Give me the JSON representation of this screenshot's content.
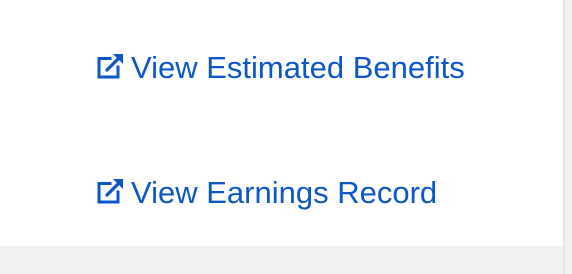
{
  "links": [
    {
      "label": "View Estimated Benefits",
      "icon": "external-link-icon"
    },
    {
      "label": "View Earnings Record",
      "icon": "external-link-icon"
    }
  ],
  "colors": {
    "link": "#0b57c7",
    "panel_background": "#ffffff",
    "page_background": "#f1f1f1",
    "divider": "#e4e4e4"
  }
}
